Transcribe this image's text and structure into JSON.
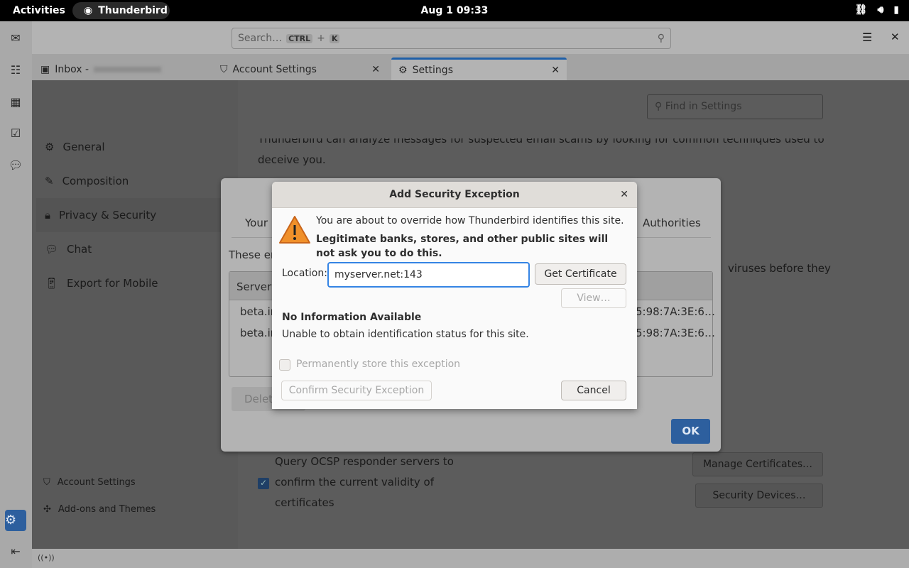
{
  "topbar": {
    "activities": "Activities",
    "app": "Thunderbird",
    "clock": "Aug 1  09:33"
  },
  "toolbar": {
    "search_placeholder": "Search…",
    "kbd1": "CTRL",
    "plus": "+",
    "kbd2": "K"
  },
  "tabs": [
    {
      "label": "Inbox -"
    },
    {
      "label": "Account Settings"
    },
    {
      "label": "Settings"
    }
  ],
  "nav": {
    "items": [
      {
        "label": "General"
      },
      {
        "label": "Composition"
      },
      {
        "label": "Privacy & Security"
      },
      {
        "label": "Chat"
      },
      {
        "label": "Export for Mobile"
      }
    ],
    "account_settings": "Account Settings",
    "addons": "Add-ons and Themes"
  },
  "main": {
    "find_placeholder": "Find in Settings",
    "scam_text1": "Thunderbird can analyze messages for suspected email scams by looking for common techniques used to",
    "scam_text2": "deceive you.",
    "viruses": "viruses before they",
    "ocsp1": "Query OCSP responder servers to",
    "ocsp2": "confirm the current validity of",
    "ocsp3": "certificates",
    "manage_certs": "Manage Certificates…",
    "security_devices": "Security Devices…"
  },
  "cert_dialog": {
    "tab_left": "Your",
    "tab_right": "Authorities",
    "these": "These en",
    "col_server": "Server",
    "rows": [
      {
        "server": "beta.ir",
        "fp": "5:98:7A:3E:6…"
      },
      {
        "server": "beta.ir",
        "fp": "5:98:7A:3E:6…"
      }
    ],
    "delete": "Delet",
    "ok": "OK"
  },
  "exception": {
    "title": "Add Security Exception",
    "warn1": "You are about to override how Thunderbird identifies this site.",
    "warn2": "Legitimate banks, stores, and other public sites will not ask you to do this.",
    "location_label": "Location:",
    "location_value": "myserver.net:143",
    "get_cert": "Get Certificate",
    "view": "View…",
    "no_info_title": "No Information Available",
    "no_info_text": "Unable to obtain identification status for this site.",
    "permanent": "Permanently store this exception",
    "confirm": "Confirm Security Exception",
    "cancel": "Cancel"
  }
}
